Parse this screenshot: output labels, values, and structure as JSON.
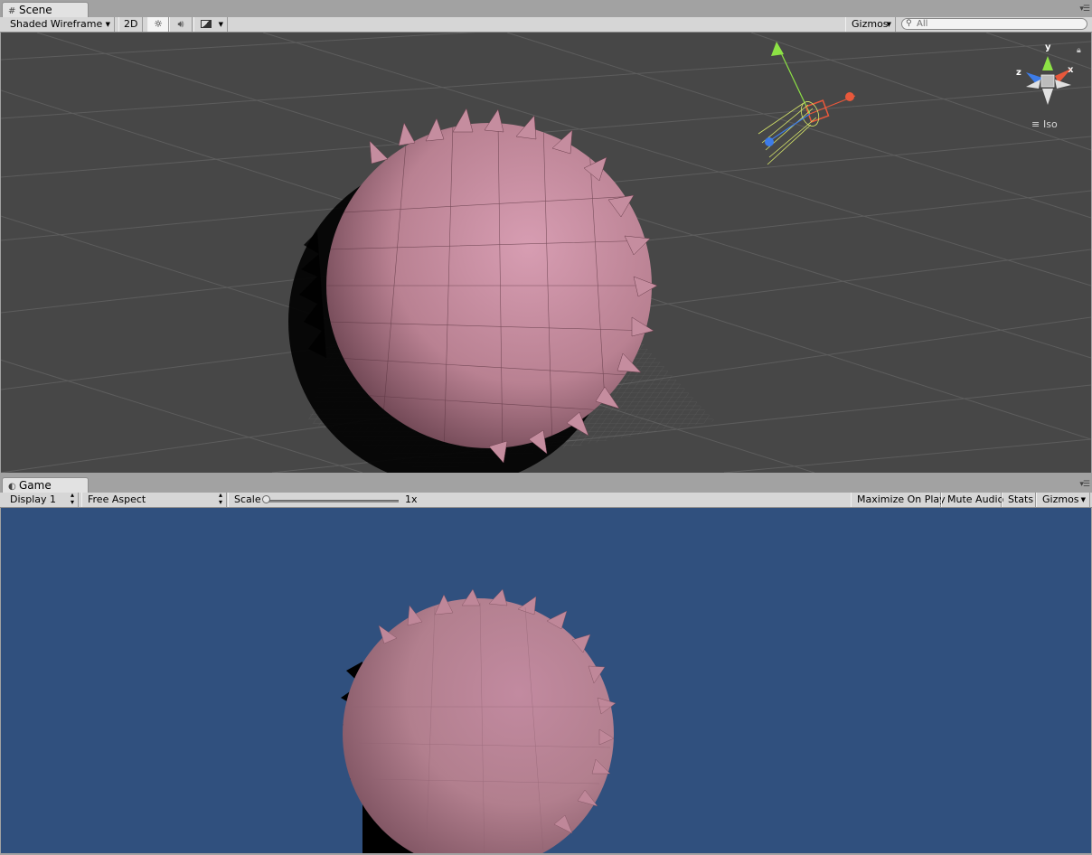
{
  "scene_tab": {
    "title": "Scene",
    "icon": "grid-icon"
  },
  "scene_toolbar": {
    "draw_mode": "Shaded Wireframe",
    "mode_2d": "2D",
    "lighting_icon": "sun-icon",
    "audio_icon": "speaker-icon",
    "effects_icon": "image-icon",
    "gizmos": "Gizmos",
    "search_placeholder": "All"
  },
  "scene_gizmo": {
    "projection": "Iso",
    "axes": [
      "y",
      "x",
      "z"
    ]
  },
  "game_tab": {
    "title": "Game",
    "icon": "pacman-icon"
  },
  "game_toolbar": {
    "display": "Display 1",
    "aspect": "Free Aspect",
    "scale_label": "Scale",
    "scale_value": "1x",
    "maximize_on_play": "Maximize On Play",
    "mute_audio": "Mute Audio",
    "stats": "Stats",
    "gizmos": "Gizmos"
  },
  "colors": {
    "scene_background": "#474747",
    "game_background": "#30507e",
    "sphere_pink": "#c58d9f",
    "gizmo_y": "#8de245",
    "gizmo_x": "#e8583b",
    "gizmo_z": "#3d7ce8"
  }
}
